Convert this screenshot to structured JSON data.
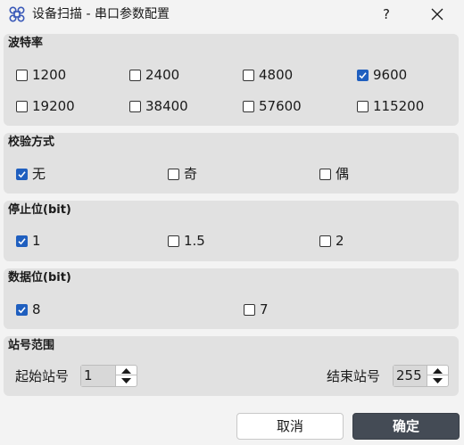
{
  "window": {
    "title": "设备扫描 - 串口参数配置",
    "help_label": "?",
    "accent_color": "#1f5fbf"
  },
  "baud_rate": {
    "title": "波特率",
    "options": [
      {
        "label": "1200",
        "checked": false
      },
      {
        "label": "2400",
        "checked": false
      },
      {
        "label": "4800",
        "checked": false
      },
      {
        "label": "9600",
        "checked": true
      },
      {
        "label": "19200",
        "checked": false
      },
      {
        "label": "38400",
        "checked": false
      },
      {
        "label": "57600",
        "checked": false
      },
      {
        "label": "115200",
        "checked": false
      }
    ]
  },
  "parity": {
    "title": "校验方式",
    "options": [
      {
        "label": "无",
        "checked": true
      },
      {
        "label": "奇",
        "checked": false
      },
      {
        "label": "偶",
        "checked": false
      }
    ]
  },
  "stop_bits": {
    "title": "停止位(bit)",
    "options": [
      {
        "label": "1",
        "checked": true
      },
      {
        "label": "1.5",
        "checked": false
      },
      {
        "label": "2",
        "checked": false
      }
    ]
  },
  "data_bits": {
    "title": "数据位(bit)",
    "options": [
      {
        "label": "8",
        "checked": true
      },
      {
        "label": "7",
        "checked": false
      }
    ]
  },
  "station_range": {
    "title": "站号范围",
    "start_label": "起始站号",
    "start_value": "1",
    "end_label": "结束站号",
    "end_value": "255"
  },
  "buttons": {
    "cancel_label": "取消",
    "ok_label": "确定"
  }
}
